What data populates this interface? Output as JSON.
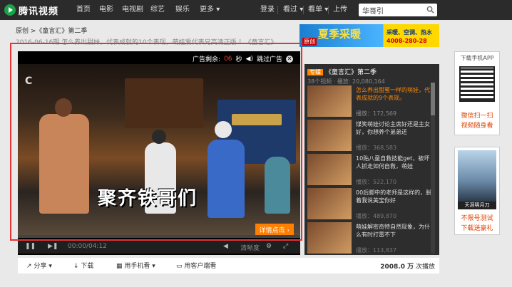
{
  "nav": {
    "logo": "腾讯视频",
    "items": [
      "首页",
      "电影",
      "电视剧",
      "综艺",
      "娱乐",
      "更多"
    ],
    "right_items": [
      "登录",
      "看过",
      "看单",
      "上传"
    ],
    "search_value": "华哥引"
  },
  "breadcrumb": "原创 >《童言汇》第二季",
  "subtitle": "2016-06-16期 怎么养出甜妹，代表成就的10个表现，萌娃爱代表兄高清正版 ！《童言汇》",
  "ad_banner": {
    "title": "夏季采暖",
    "badge": "原创",
    "line1": "采暖、空调、热水",
    "line2": "4008-280-28"
  },
  "player": {
    "ad_label": "广告剩余:",
    "ad_seconds": "06",
    "ad_unit": "秒",
    "skip_ad": "跳过广告",
    "caption": "聚齐铁哥们",
    "detail_button": "详情点击",
    "time": "00:00/04:12",
    "danmaku": "清晰度"
  },
  "playlist": {
    "tag": "专辑",
    "title": "《童言汇》第二季",
    "meta": "38个视频 · 播放: 20,080,164",
    "items": [
      {
        "title": "怎么养出甜蜜一样的萌娃，代表成就的9个表现。",
        "plays": "172,569",
        "active": true
      },
      {
        "title": "煤笑萌娃讨论主席好还是主女好，你想养个弟弟还",
        "plays": "368,583",
        "active": false
      },
      {
        "title": "10贴八童自救技能get，被坏人抓走如何自救，萌娃",
        "plays": "522,170",
        "active": false
      },
      {
        "title": "00后脚中的老师是这样的，脱着我说美宝你好",
        "plays": "489,870",
        "active": false
      },
      {
        "title": "萌娃解密奇特自然现象，为什么有时打雷不下",
        "plays": "113,837",
        "active": false
      }
    ],
    "plays_label": "播放："
  },
  "share_bar": {
    "items": [
      "分享",
      "下载",
      "用手机看",
      "用客户端看"
    ],
    "play_count": "2008.0 万",
    "play_count_suffix": "次播放"
  },
  "side": {
    "app_title": "下载手机APP",
    "app_line1": "微信扫一扫",
    "app_line2": "视频随身看",
    "promo_caption": "天涯明月刀",
    "promo_line1": "不限号测试",
    "promo_line2": "下载送豪礼"
  },
  "colors": {
    "accent": "#ff8400",
    "highlight": "#e63336",
    "nav_bg": "#2b2b2b"
  }
}
